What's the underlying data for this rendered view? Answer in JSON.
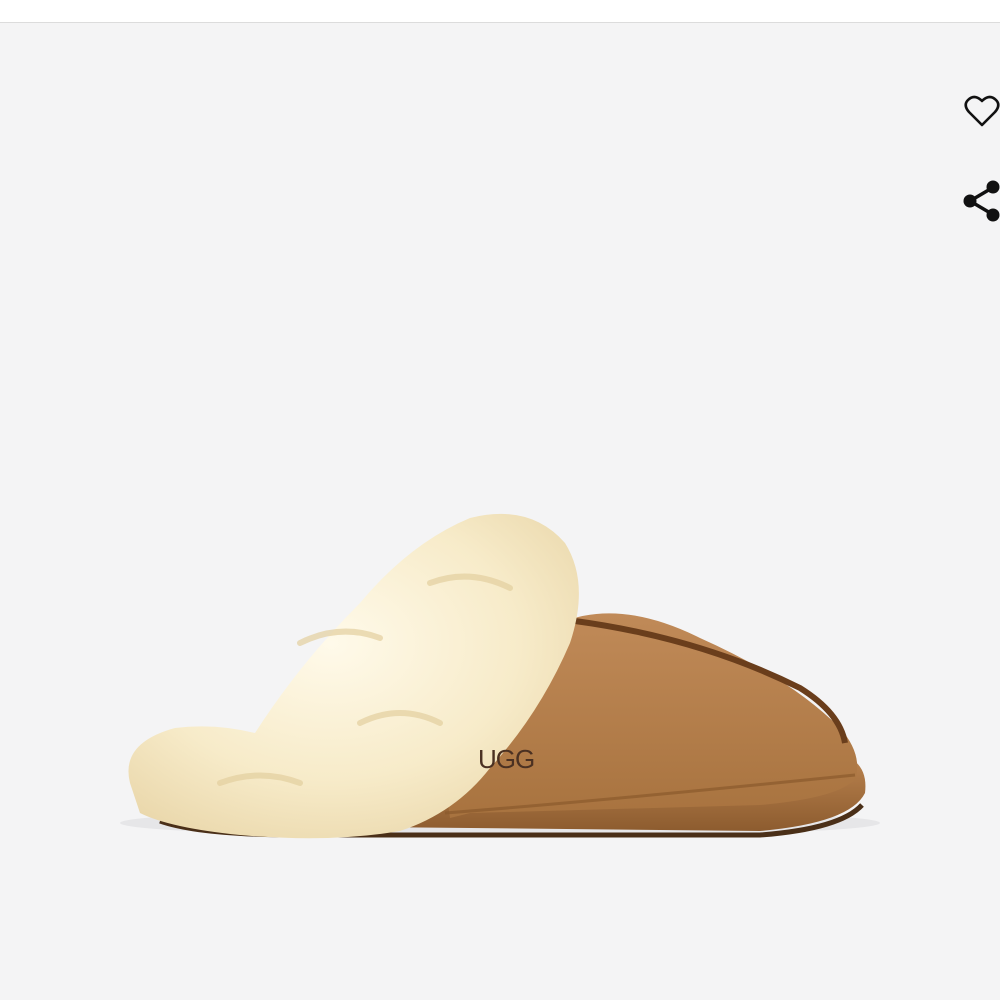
{
  "product": {
    "brand_mark": "UGG",
    "image_description_name": "slipper"
  },
  "actions": {
    "wishlist_icon": "heart-outline-icon",
    "share_icon": "share-icon"
  },
  "colors": {
    "background": "#f4f4f5",
    "suede": "#b8804f",
    "fur": "#f6e9c8",
    "icon": "#111111"
  }
}
